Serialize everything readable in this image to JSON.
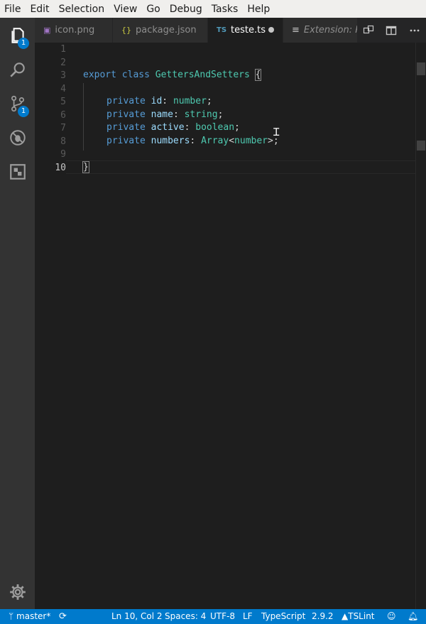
{
  "menu": [
    "File",
    "Edit",
    "Selection",
    "View",
    "Go",
    "Debug",
    "Tasks",
    "Help"
  ],
  "activity": {
    "explorer_badge": "1",
    "scm_badge": "1"
  },
  "tabs": [
    {
      "label": "icon.png",
      "icon": "image-file-icon",
      "glyph": "▣"
    },
    {
      "label": "package.json",
      "icon": "json-file-icon",
      "glyph": "{}"
    },
    {
      "label": "teste.ts",
      "icon": "typescript-file-icon",
      "glyph": "TS"
    },
    {
      "label": "Extension: PH",
      "icon": "extension-preview-icon",
      "glyph": "≡"
    }
  ],
  "line_numbers": [
    "1",
    "2",
    "3",
    "4",
    "5",
    "6",
    "7",
    "8",
    "9",
    "10"
  ],
  "code": {
    "l3_kw1": "export",
    "l3_kw2": "class",
    "l3_name": "GettersAndSetters",
    "l3_brace": "{",
    "l5": {
      "kw": "private",
      "prop": "id",
      "type": "number"
    },
    "l6": {
      "kw": "private",
      "prop": "name",
      "type": "string"
    },
    "l7": {
      "kw": "private",
      "prop": "active",
      "type": "boolean"
    },
    "l8": {
      "kw": "private",
      "prop": "numbers",
      "type": "Array",
      "generic": "number"
    },
    "l10_brace": "}"
  },
  "status": {
    "branch": "master*",
    "position": "Ln 10, Col 2",
    "spaces": "Spaces: 4",
    "encoding": "UTF-8",
    "eol": "LF",
    "language": "TypeScript",
    "version": "2.9.2",
    "linter": "TSLint"
  },
  "colors": {
    "accent": "#007acc",
    "keyword": "#569cd6",
    "type": "#4ec9b0",
    "property": "#9cdcfe"
  }
}
